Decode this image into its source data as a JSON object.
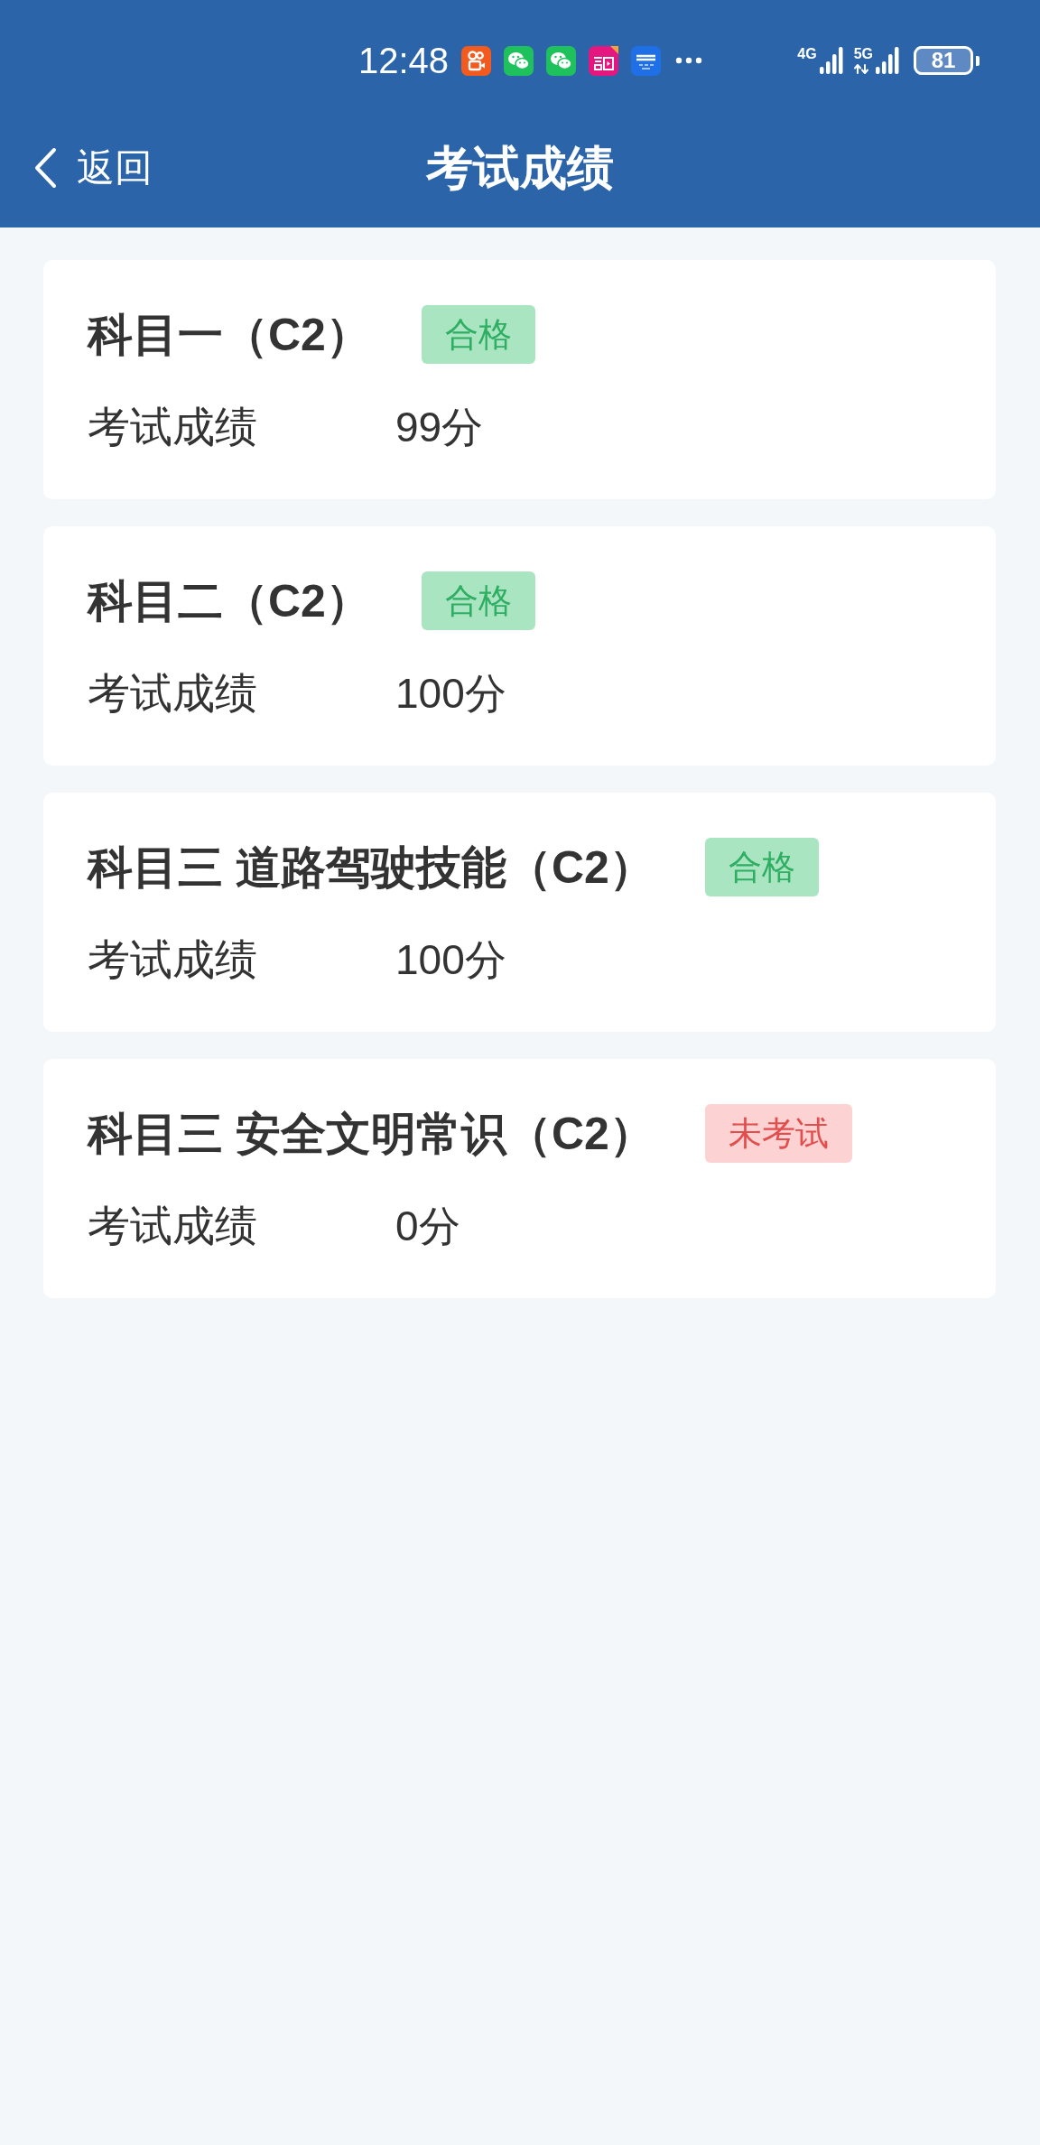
{
  "status_bar": {
    "time": "12:48",
    "signals": [
      {
        "label": "4G",
        "data_activity": false
      },
      {
        "label": "5G",
        "data_activity": true
      }
    ],
    "battery": "81"
  },
  "nav_bar": {
    "back": "返回",
    "title": "考试成绩"
  },
  "cards": [
    {
      "subject": "科目一（C2）",
      "status": {
        "kind": "pass",
        "label": "合格"
      },
      "score_label": "考试成绩",
      "score": "99分"
    },
    {
      "subject": "科目二（C2）",
      "status": {
        "kind": "pass",
        "label": "合格"
      },
      "score_label": "考试成绩",
      "score": "100分"
    },
    {
      "subject": "科目三 道路驾驶技能（C2）",
      "status": {
        "kind": "pass",
        "label": "合格"
      },
      "score_label": "考试成绩",
      "score": "100分"
    },
    {
      "subject": "科目三 安全文明常识（C2）",
      "status": {
        "kind": "not_taken",
        "label": "未考试"
      },
      "score_label": "考试成绩",
      "score": "0分"
    }
  ]
}
